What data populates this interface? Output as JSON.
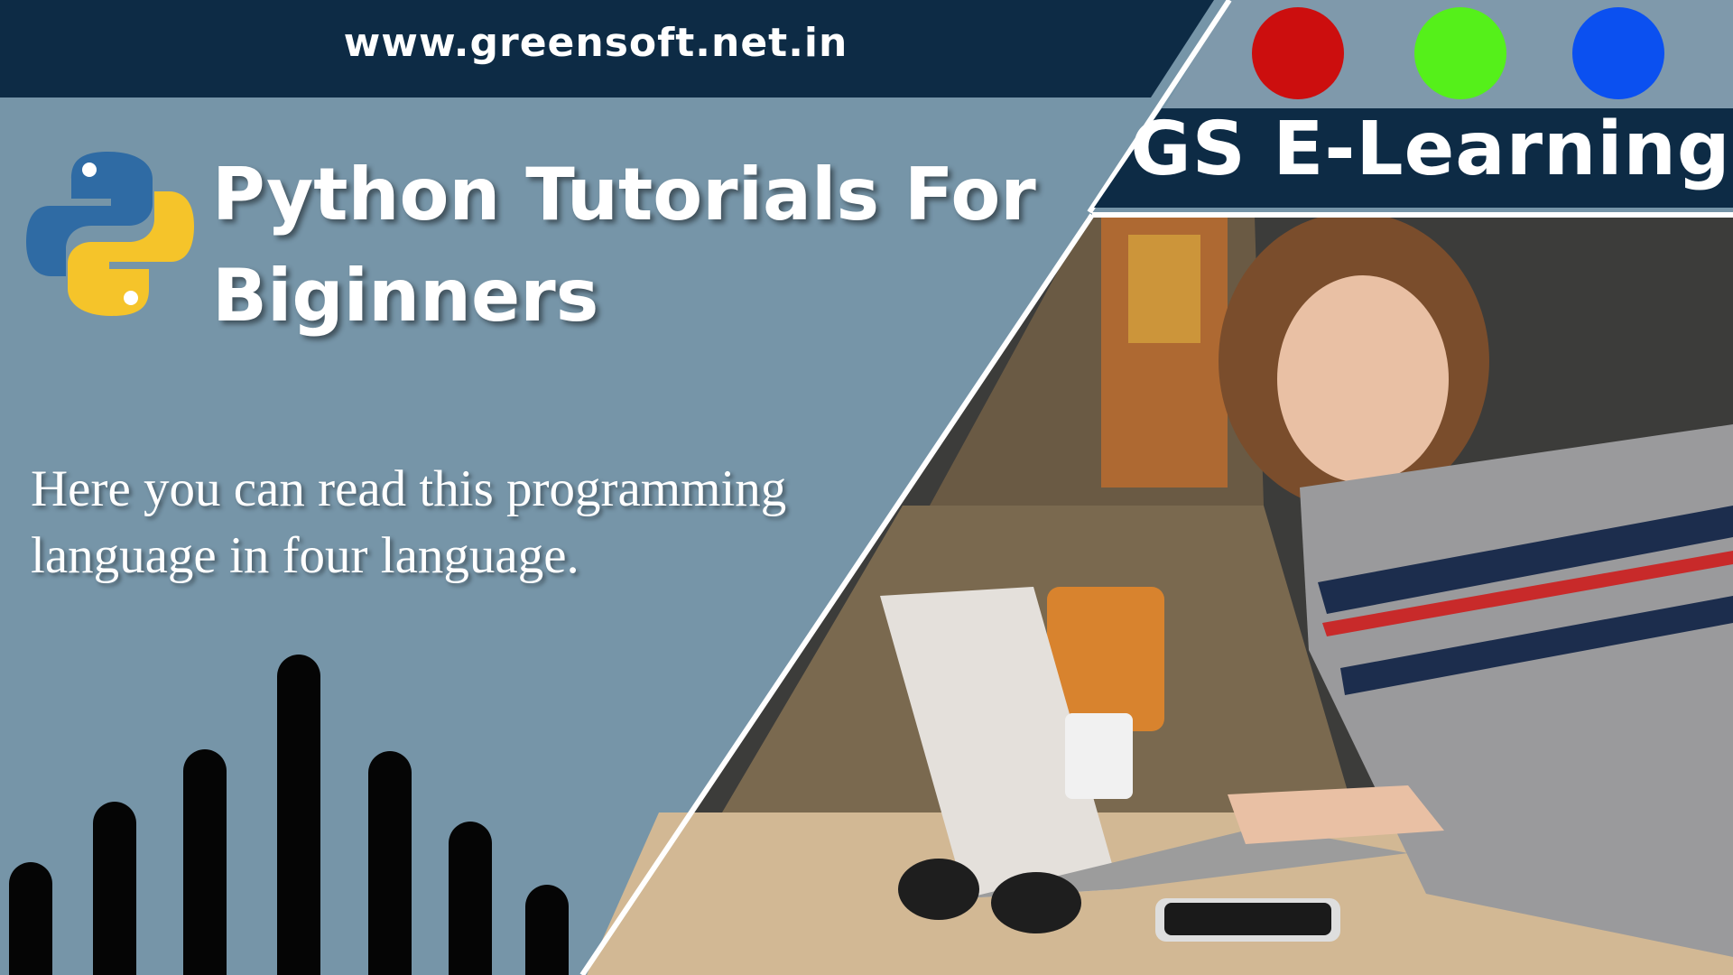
{
  "header": {
    "url": "www.greensoft.net.in"
  },
  "brand": {
    "name": "GS E-Learning"
  },
  "title": {
    "line1": "Python Tutorials For",
    "line2": "Biginners"
  },
  "description": {
    "line1": "Here you can read this programming",
    "line2": "language in four language."
  },
  "colors": {
    "background": "#7695a8",
    "navy": "#0d2b45",
    "dot_red": "#cc0e0e",
    "dot_green": "#55f01a",
    "dot_blue": "#0b50f0",
    "bars": "#050505",
    "python_blue": "#2f6ba4",
    "python_yellow": "#f5c42a"
  },
  "icons": {
    "logo": "python-logo-icon"
  },
  "photo": {
    "subject": "woman-using-laptop-photo"
  }
}
